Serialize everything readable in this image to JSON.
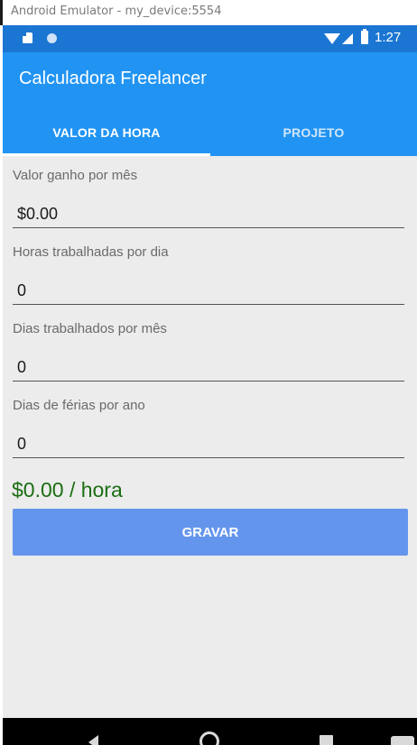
{
  "window": {
    "title": "Android Emulator - my_device:5554"
  },
  "status_bar": {
    "time": "1:27",
    "icons": [
      "sd-card-icon",
      "notification-dot-icon",
      "wifi-icon",
      "signal-icon",
      "battery-icon"
    ],
    "color": "#1a76d2"
  },
  "app": {
    "title": "Calculadora Freelancer",
    "bar_color": "#2194f3"
  },
  "tabs": [
    {
      "label": "VALOR DA HORA",
      "selected": true
    },
    {
      "label": "PROJETO",
      "selected": false
    }
  ],
  "form": {
    "fields": [
      {
        "label": "Valor ganho por mês",
        "value": "$0.00"
      },
      {
        "label": "Horas trabalhadas por dia",
        "value": "0"
      },
      {
        "label": "Dias trabalhados por mês",
        "value": "0"
      },
      {
        "label": "Dias de férias por ano",
        "value": "0"
      }
    ]
  },
  "result": {
    "text": "$0.00 / hora",
    "color": "#1b6e12"
  },
  "actions": {
    "save_label": "GRAVAR",
    "button_color": "#6495ed"
  },
  "nav_bar": {
    "icons": [
      "back-icon",
      "home-icon",
      "recents-icon"
    ]
  }
}
